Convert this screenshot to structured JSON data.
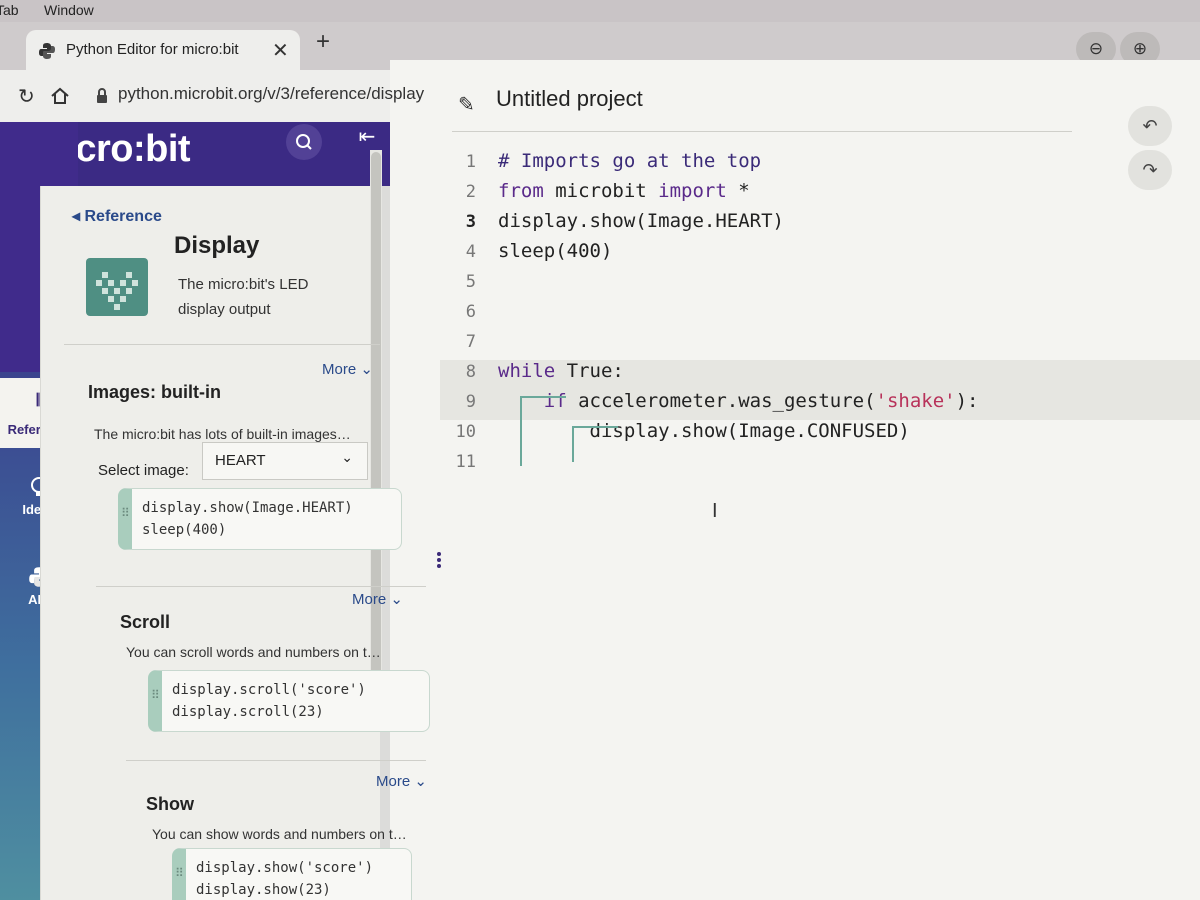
{
  "browser": {
    "menu": [
      "Tab",
      "Window"
    ],
    "tab_title": "Python Editor for micro:bit",
    "tab_close": "✕",
    "new_tab": "+",
    "url": "python.microbit.org/v/3/reference/display",
    "zoom_out": "⊖",
    "zoom_in": "⊕"
  },
  "brand": "micro:bit",
  "rail": {
    "items": [
      {
        "label": "Reference",
        "icon": "books-icon"
      },
      {
        "label": "Ideas",
        "icon": "lightbulb-icon"
      },
      {
        "label": "API",
        "icon": "python-icon"
      }
    ]
  },
  "reference": {
    "back_label": "Reference",
    "topic_title": "Display",
    "topic_desc": "The micro:bit's LED display output",
    "sections": [
      {
        "title": "Images: built-in",
        "desc": "The micro:bit has lots of built-in images…",
        "more": "More",
        "select_label": "Select image:",
        "select_value": "HEART",
        "code": [
          "display.show(Image.HEART)",
          "sleep(400)"
        ]
      },
      {
        "title": "Scroll",
        "desc": "You can scroll words and numbers on t…",
        "more": "More",
        "code": [
          "display.scroll('score')",
          "display.scroll(23)"
        ]
      },
      {
        "title": "Show",
        "desc": "You can show words and numbers on t…",
        "more": "More",
        "code": [
          "display.show('score')",
          "display.show(23)"
        ]
      }
    ]
  },
  "editor": {
    "project_name": "Untitled project",
    "undo": "↶",
    "redo": "↷",
    "lines": [
      {
        "n": "1",
        "indent": "",
        "parts": [
          {
            "t": "# Imports go at the top",
            "c": "cm"
          }
        ]
      },
      {
        "n": "2",
        "indent": "",
        "parts": [
          {
            "t": "from",
            "c": "kw"
          },
          {
            "t": " microbit ",
            "c": ""
          },
          {
            "t": "import",
            "c": "kw"
          },
          {
            "t": " *",
            "c": ""
          }
        ]
      },
      {
        "n": "3",
        "indent": "",
        "parts": [
          {
            "t": "display.show(Image.HEART)",
            "c": ""
          }
        ]
      },
      {
        "n": "4",
        "indent": "",
        "parts": [
          {
            "t": "sleep(400)",
            "c": ""
          }
        ]
      },
      {
        "n": "5",
        "indent": "",
        "parts": []
      },
      {
        "n": "6",
        "indent": "",
        "parts": []
      },
      {
        "n": "7",
        "indent": "",
        "parts": []
      },
      {
        "n": "8",
        "indent": "",
        "parts": [
          {
            "t": "while",
            "c": "kw"
          },
          {
            "t": " True:",
            "c": ""
          }
        ]
      },
      {
        "n": "9",
        "indent": "    ",
        "parts": [
          {
            "t": "if",
            "c": "kw"
          },
          {
            "t": " accelerometer.was_gesture(",
            "c": ""
          },
          {
            "t": "'shake'",
            "c": "str"
          },
          {
            "t": "):",
            "c": ""
          }
        ]
      },
      {
        "n": "10",
        "indent": "        ",
        "parts": [
          {
            "t": "display.show(Image.CONFUSED)",
            "c": ""
          }
        ]
      },
      {
        "n": "11",
        "indent": "",
        "parts": []
      }
    ]
  }
}
